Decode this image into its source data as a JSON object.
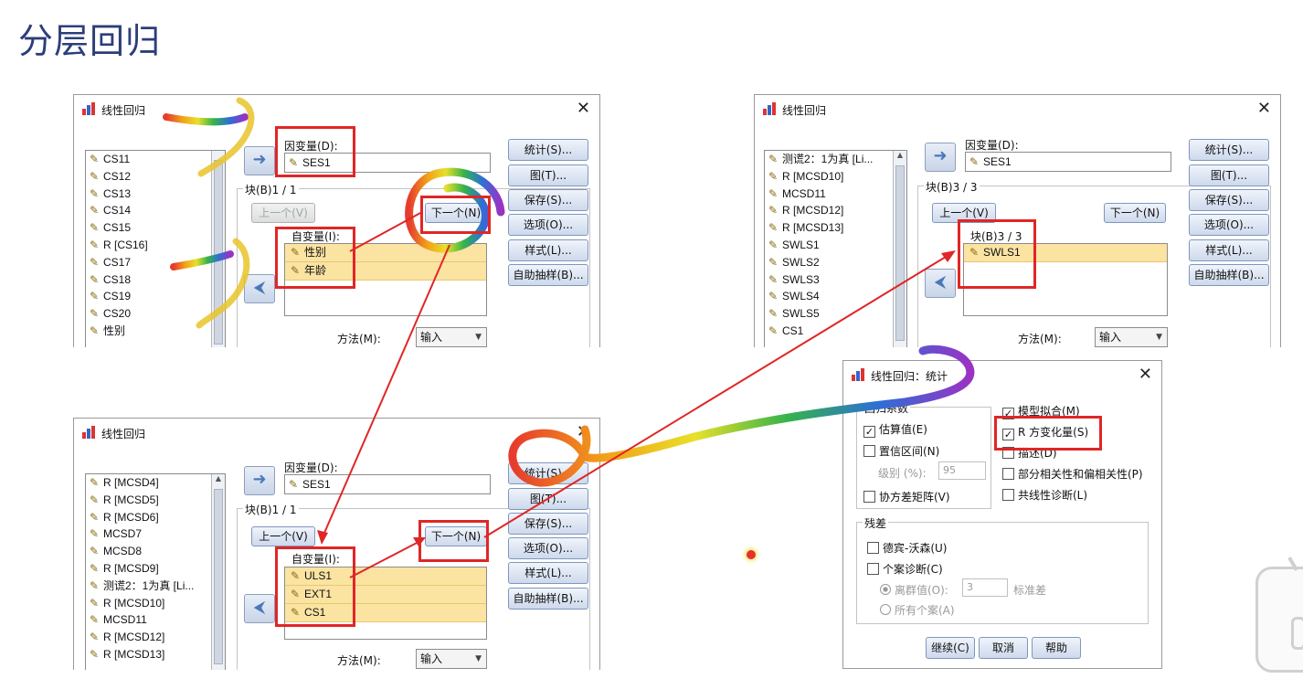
{
  "slide_title": "分层回归",
  "dialog1": {
    "title": "线性回归",
    "source_vars": [
      "CS11",
      "CS12",
      "CS13",
      "CS14",
      "CS15",
      "R [CS16]",
      "CS17",
      "CS18",
      "CS19",
      "CS20",
      "性别"
    ],
    "dep_label": "因变量(D):",
    "dep_value": "SES1",
    "block_label": "块(B)1 / 1",
    "prev_label": "上一个(V)",
    "next_label": "下一个(N)",
    "indep_label": "自变量(I):",
    "indep_vars": [
      "性别",
      "年龄"
    ],
    "method_label": "方法(M):",
    "method_value": "输入",
    "buttons": [
      "统计(S)...",
      "图(T)...",
      "保存(S)...",
      "选项(O)...",
      "样式(L)...",
      "自助抽样(B)..."
    ]
  },
  "dialog2": {
    "title": "线性回归",
    "source_vars": [
      "R [MCSD4]",
      "R [MCSD5]",
      "R [MCSD6]",
      "MCSD7",
      "MCSD8",
      "R [MCSD9]",
      "测谎2：1为真 [Li...",
      "R [MCSD10]",
      "MCSD11",
      "R [MCSD12]",
      "R [MCSD13]"
    ],
    "dep_label": "因变量(D):",
    "dep_value": "SES1",
    "block_label": "块(B)1 / 1",
    "prev_label": "上一个(V)",
    "next_label": "下一个(N)",
    "indep_label": "自变量(I):",
    "indep_vars": [
      "ULS1",
      "EXT1",
      "CS1"
    ],
    "method_label": "方法(M):",
    "method_value": "输入",
    "buttons": [
      "统计(S)...",
      "图(T)...",
      "保存(S)...",
      "选项(O)...",
      "样式(L)...",
      "自助抽样(B)..."
    ]
  },
  "dialog3": {
    "title": "线性回归",
    "source_vars": [
      "测谎2：1为真 [Li...",
      "R [MCSD10]",
      "MCSD11",
      "R [MCSD12]",
      "R [MCSD13]",
      "SWLS1",
      "SWLS2",
      "SWLS3",
      "SWLS4",
      "SWLS5",
      "CS1"
    ],
    "dep_label": "因变量(D):",
    "dep_value": "SES1",
    "block_label": "块(B)3 / 3",
    "block_inner_label": "块(B)3 / 3",
    "prev_label": "上一个(V)",
    "next_label": "下一个(N)",
    "indep_vars": [
      "SWLS1"
    ],
    "method_label": "方法(M):",
    "method_value": "输入",
    "buttons": [
      "统计(S)...",
      "图(T)...",
      "保存(S)...",
      "选项(O)...",
      "样式(L)...",
      "自助抽样(B)..."
    ]
  },
  "dialog4": {
    "title": "线性回归：统计",
    "group_label": "回归系数",
    "estimate": "估算值(E)",
    "ci": "置信区间(N)",
    "level_label": "级别 (%):",
    "level_value": "95",
    "cov": "协方差矩阵(V)",
    "model_fit": "模型拟合(M)",
    "r_change": "R 方变化量(S)",
    "desc": "描述(D)",
    "partial": "部分相关性和偏相关性(P)",
    "collinear": "共线性诊断(L)",
    "resid_label": "残差",
    "durbin": "德宾-沃森(U)",
    "casewise": "个案诊断(C)",
    "outliers": "离群值(O):",
    "outliers_value": "3",
    "sd_label": "标准差",
    "all_cases": "所有个案(A)",
    "continue": "继续(C)",
    "cancel": "取消",
    "help": "帮助"
  }
}
